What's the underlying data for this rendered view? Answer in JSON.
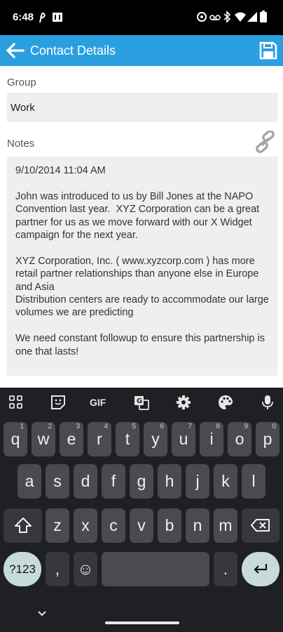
{
  "status_bar": {
    "time": "6:48",
    "icons": [
      "pinterest-icon",
      "briefcase-icon",
      "at-icon",
      "voicemail-icon",
      "bluetooth-icon",
      "wifi-icon",
      "signal-icon",
      "battery-icon"
    ]
  },
  "app_bar": {
    "title": "Contact Details",
    "back_icon": "arrow-left-icon",
    "save_icon": "floppy-disk-icon",
    "background": "#2a9fe0"
  },
  "form": {
    "group_label": "Group",
    "group_value": "Work",
    "notes_label": "Notes",
    "notes_value": "9/10/2014 11:04 AM\n\nJohn was introduced to us by Bill Jones at the NAPO Convention last year.  XYZ Corporation can be a great partner for us as we move forward with our X Widget campaign for the next year.\n\nXYZ Corporation, Inc. ( www.xyzcorp.com ) has more retail partner relationships than anyone else in Europe and Asia\nDistribution centers are ready to accommodate our large volumes we are predicting\n\nWe need constant followup to ensure this partnership is one that lasts!",
    "link_icon": "chain-link-icon"
  },
  "keyboard": {
    "toolbar": [
      "apps-grid-icon",
      "sticker-icon",
      "GIF",
      "translate-icon",
      "gear-icon",
      "palette-icon",
      "microphone-icon"
    ],
    "gif_label": "GIF",
    "row1": [
      {
        "k": "q",
        "h": "1"
      },
      {
        "k": "w",
        "h": "2"
      },
      {
        "k": "e",
        "h": "3"
      },
      {
        "k": "r",
        "h": "4"
      },
      {
        "k": "t",
        "h": "5"
      },
      {
        "k": "y",
        "h": "6"
      },
      {
        "k": "u",
        "h": "7"
      },
      {
        "k": "i",
        "h": "8"
      },
      {
        "k": "o",
        "h": "9"
      },
      {
        "k": "p",
        "h": "0"
      }
    ],
    "row2": [
      "a",
      "s",
      "d",
      "f",
      "g",
      "h",
      "j",
      "k",
      "l"
    ],
    "row3": [
      "z",
      "x",
      "c",
      "v",
      "b",
      "n",
      "m"
    ],
    "symbols_label": "?123",
    "comma_label": ",",
    "period_label": ".",
    "emoji_label": "☺"
  }
}
